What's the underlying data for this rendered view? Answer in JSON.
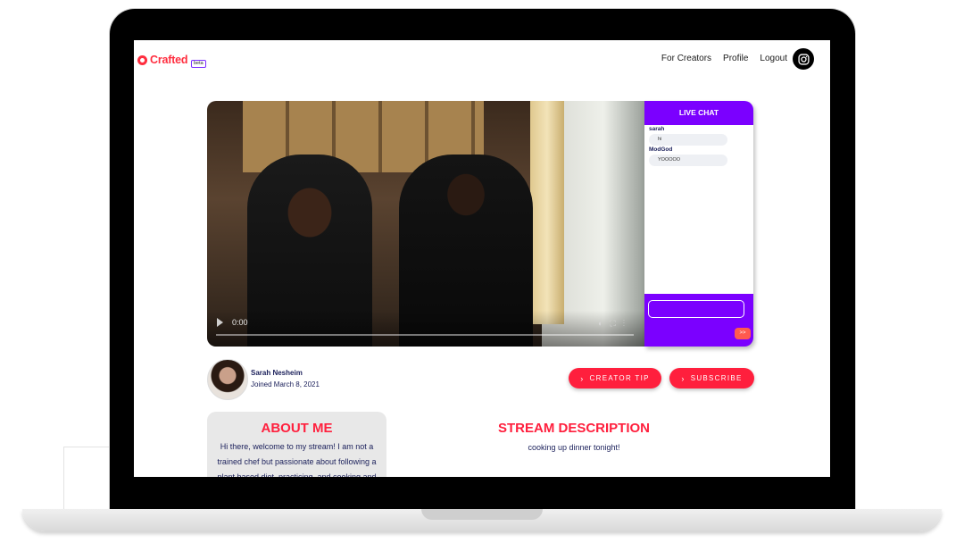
{
  "brand": {
    "name": "Crafted",
    "badge": "beta",
    "color": "#ff2e3f"
  },
  "nav": {
    "items": [
      "For Creators",
      "Profile",
      "Logout"
    ],
    "social_icon": "instagram-icon"
  },
  "video": {
    "time": "0:00"
  },
  "chat": {
    "title": "LIVE CHAT",
    "messages": [
      {
        "user": "sarah",
        "text": "hi"
      },
      {
        "user": "ModGod",
        "text": "YOOOOO"
      }
    ],
    "input_value": "",
    "send_label": ">>",
    "accent": "#7b00ff"
  },
  "creator": {
    "name": "Sarah Nesheim",
    "joined": "Joined  March 8, 2021"
  },
  "actions": {
    "tip_label": "CREATOR TIP",
    "subscribe_label": "SUBSCRIBE",
    "button_color": "#ff1f3d"
  },
  "about": {
    "title": "ABOUT ME",
    "text": "Hi there, welcome to my stream! I am not a trained chef but passionate about following a plant based diet, practicing, and cooking and"
  },
  "stream_description": {
    "title": "STREAM DESCRIPTION",
    "text": "cooking up dinner tonight!"
  }
}
